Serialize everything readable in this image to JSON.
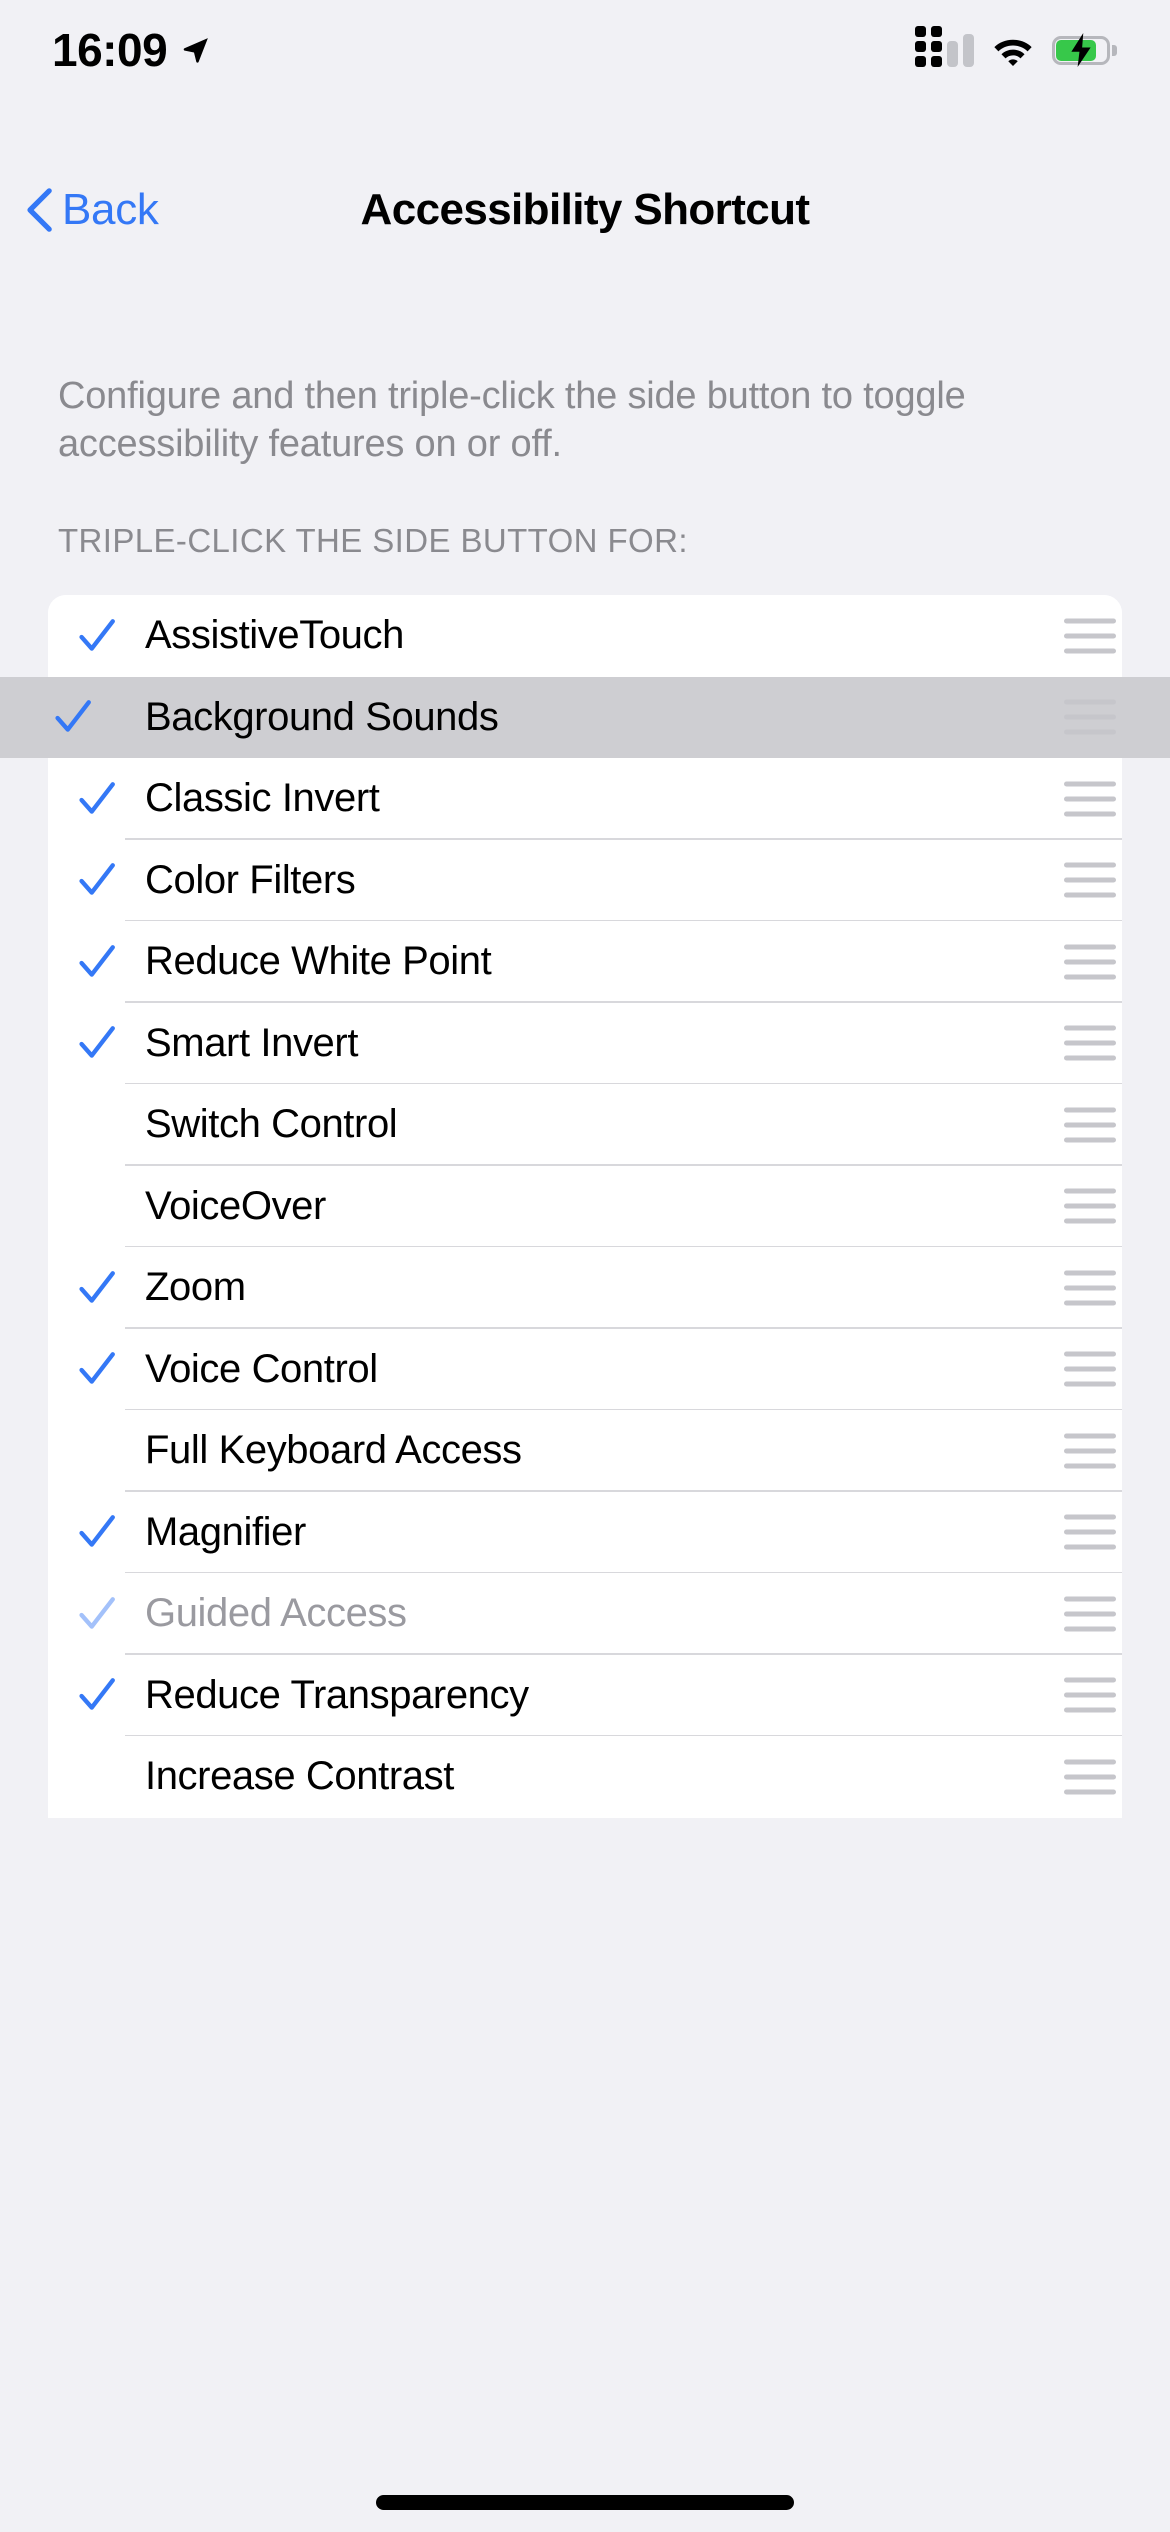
{
  "status_bar": {
    "time": "16:09",
    "location_icon": "location-arrow-icon",
    "cellular_icon": "cellular-signal-icon",
    "wifi_icon": "wifi-icon",
    "battery_icon": "battery-charging-icon",
    "battery_color": "#37C84A"
  },
  "nav": {
    "back_label": "Back",
    "back_icon": "chevron-left-icon",
    "title": "Accessibility Shortcut",
    "accent_color": "#3478F6"
  },
  "content": {
    "description": "Configure and then triple-click the side button to toggle accessibility features on or off.",
    "section_header": "TRIPLE-CLICK THE SIDE BUTTON FOR:"
  },
  "list": {
    "rows": [
      {
        "label": "AssistiveTouch",
        "checked": true,
        "dimmed": false,
        "highlighted": false
      },
      {
        "label": "Background Sounds",
        "checked": true,
        "dimmed": false,
        "highlighted": true
      },
      {
        "label": "Classic Invert",
        "checked": true,
        "dimmed": false,
        "highlighted": false
      },
      {
        "label": "Color Filters",
        "checked": true,
        "dimmed": false,
        "highlighted": false
      },
      {
        "label": "Reduce White Point",
        "checked": true,
        "dimmed": false,
        "highlighted": false
      },
      {
        "label": "Smart Invert",
        "checked": true,
        "dimmed": false,
        "highlighted": false
      },
      {
        "label": "Switch Control",
        "checked": false,
        "dimmed": false,
        "highlighted": false
      },
      {
        "label": "VoiceOver",
        "checked": false,
        "dimmed": false,
        "highlighted": false
      },
      {
        "label": "Zoom",
        "checked": true,
        "dimmed": false,
        "highlighted": false
      },
      {
        "label": "Voice Control",
        "checked": true,
        "dimmed": false,
        "highlighted": false
      },
      {
        "label": "Full Keyboard Access",
        "checked": false,
        "dimmed": false,
        "highlighted": false
      },
      {
        "label": "Magnifier",
        "checked": true,
        "dimmed": false,
        "highlighted": false
      },
      {
        "label": "Guided Access",
        "checked": true,
        "dimmed": true,
        "highlighted": false
      },
      {
        "label": "Reduce Transparency",
        "checked": true,
        "dimmed": false,
        "highlighted": false
      },
      {
        "label": "Increase Contrast",
        "checked": false,
        "dimmed": false,
        "highlighted": false
      }
    ],
    "reorder_handle_icon": "reorder-handle-icon",
    "check_icon": "checkmark-icon",
    "check_color": "#3478F6",
    "highlight_color": "#CECED2"
  },
  "home_indicator": "home-indicator"
}
